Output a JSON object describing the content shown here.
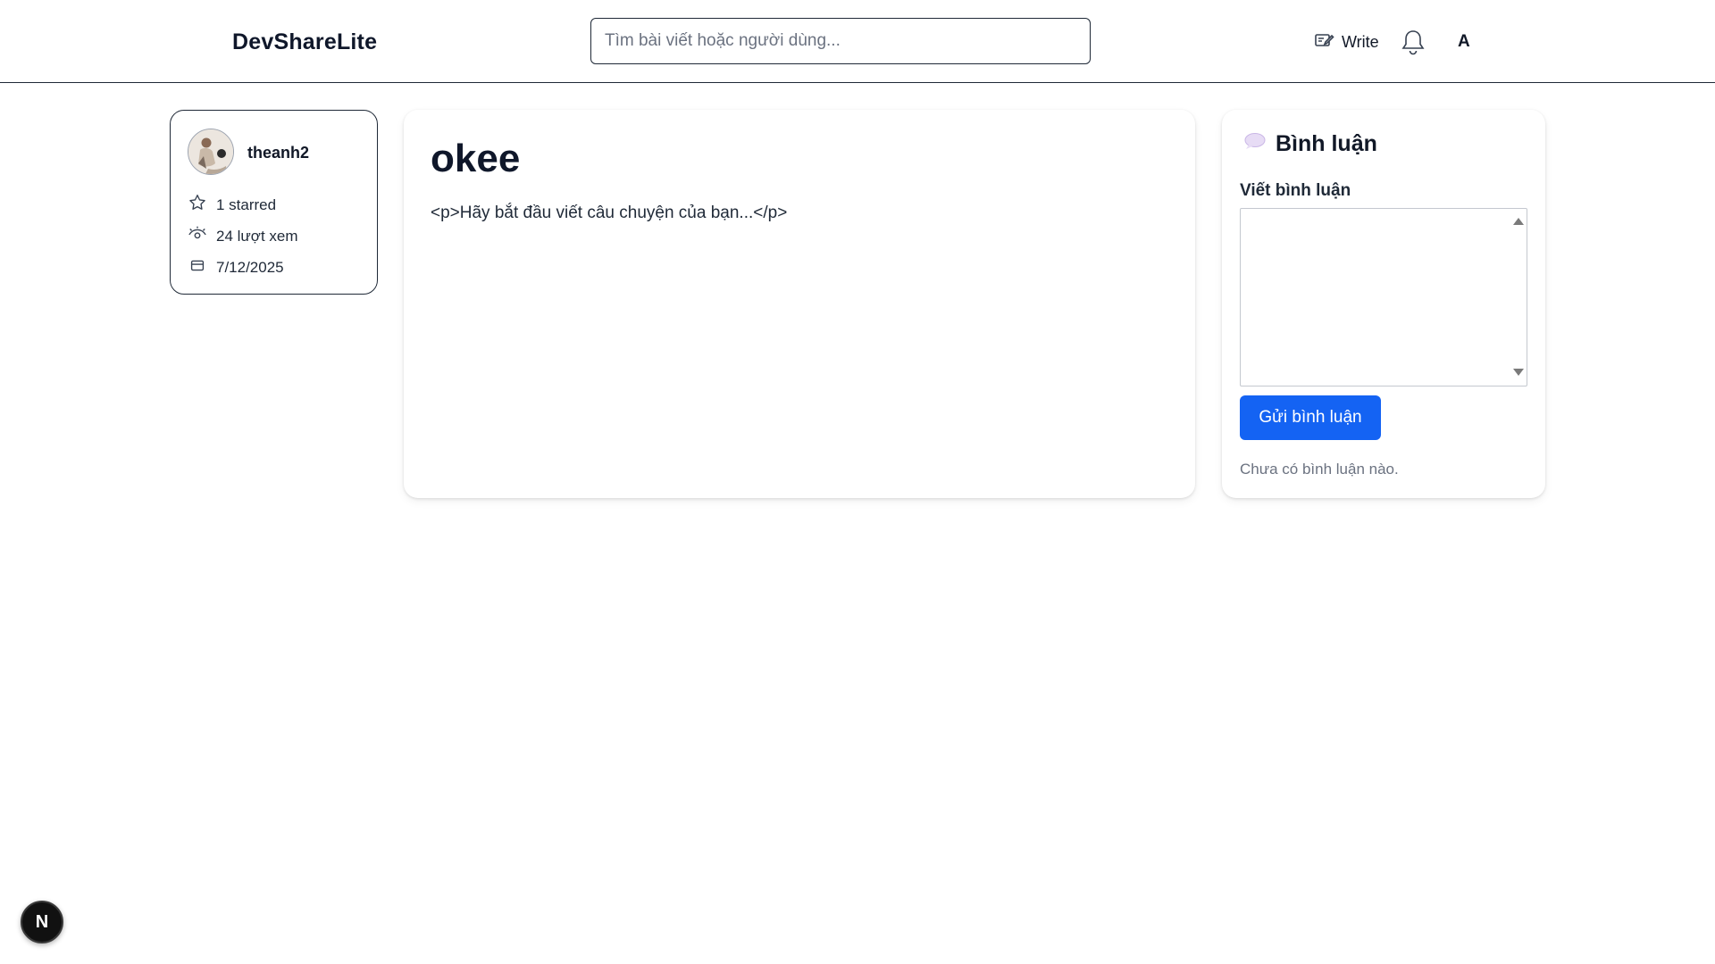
{
  "header": {
    "logo": "DevShareLite",
    "search_placeholder": "Tìm bài viết hoặc người dùng...",
    "write_label": "Write",
    "user_initial": "A"
  },
  "author": {
    "username": "theanh2",
    "stars": "1 starred",
    "views": "24 lượt xem",
    "date": "7/12/2025"
  },
  "article": {
    "title": "okee",
    "body": "<p>Hãy bắt đầu viết câu chuyện của bạn...</p>"
  },
  "comments": {
    "title": "Bình luận",
    "label": "Viết bình luận",
    "submit_label": "Gửi bình luận",
    "empty_text": "Chưa có bình luận nào."
  },
  "badge": {
    "letter": "N"
  },
  "colors": {
    "accent": "#1463f3",
    "border": "#1f2937",
    "muted": "#6b7280"
  }
}
